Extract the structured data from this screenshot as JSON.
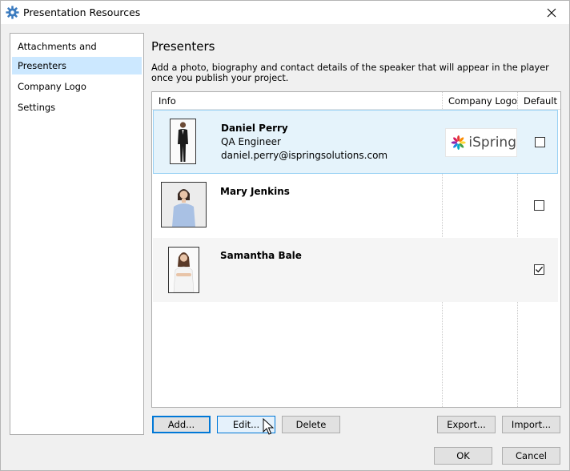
{
  "window": {
    "title": "Presentation Resources"
  },
  "sidebar": {
    "items": [
      {
        "label": "Attachments and Hyperlinks",
        "selected": false
      },
      {
        "label": "Presenters",
        "selected": true
      },
      {
        "label": "Company Logo",
        "selected": false
      },
      {
        "label": "Settings",
        "selected": false
      }
    ]
  },
  "main": {
    "title": "Presenters",
    "description": "Add a photo, biography and contact details of the speaker that will appear in the player once you publish your project."
  },
  "grid": {
    "columns": {
      "info": "Info",
      "logo": "Company Logo",
      "default": "Default"
    },
    "rows": [
      {
        "name": "Daniel Perry",
        "role": "QA Engineer",
        "email": "daniel.perry@ispringsolutions.com",
        "logo_text": "iSpring",
        "default": false,
        "selected": true
      },
      {
        "name": "Mary Jenkins",
        "role": "",
        "email": "",
        "logo_text": "",
        "default": false,
        "selected": false
      },
      {
        "name": "Samantha Bale",
        "role": "",
        "email": "",
        "logo_text": "",
        "default": true,
        "selected": false
      }
    ]
  },
  "buttons": {
    "add": "Add...",
    "edit": "Edit...",
    "delete": "Delete",
    "export": "Export...",
    "import": "Import...",
    "ok": "OK",
    "cancel": "Cancel"
  },
  "colors": {
    "accent": "#0078d7",
    "selection": "#cce8ff",
    "row_selection": "#e5f3fb"
  }
}
